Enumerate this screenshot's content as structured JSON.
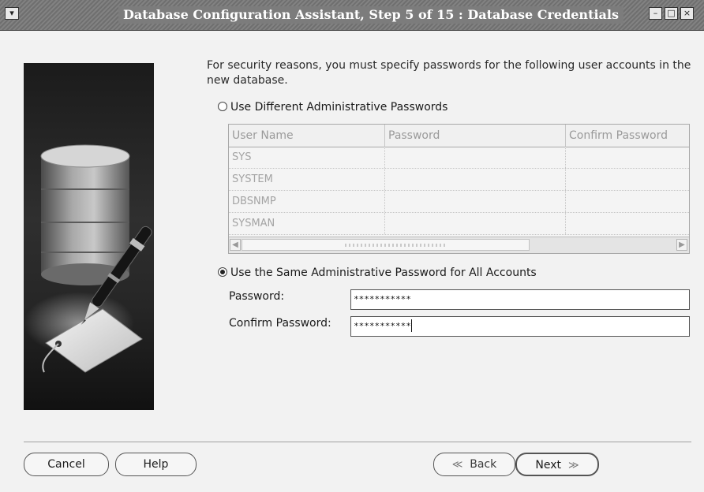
{
  "window": {
    "title": "Database Configuration Assistant, Step 5 of 15 : Database Credentials",
    "menu_icon": "chevron-down-icon",
    "controls": [
      "minimize-icon",
      "maximize-icon",
      "close-icon"
    ]
  },
  "main": {
    "intro": "For security reasons, you must specify passwords for the following user accounts in the new database.",
    "option_different": "Use Different Administrative Passwords",
    "table": {
      "headers": [
        "User Name",
        "Password",
        "Confirm Password"
      ],
      "rows": [
        [
          "SYS",
          "",
          ""
        ],
        [
          "SYSTEM",
          "",
          ""
        ],
        [
          "DBSNMP",
          "",
          ""
        ],
        [
          "SYSMAN",
          "",
          ""
        ]
      ]
    },
    "option_same": "Use the Same Administrative Password for All Accounts",
    "password_label": "Password:",
    "password_value": "***********",
    "confirm_label": "Confirm Password:",
    "confirm_value": "***********"
  },
  "footer": {
    "cancel": "Cancel",
    "help": "Help",
    "back": "Back",
    "next": "Next"
  }
}
